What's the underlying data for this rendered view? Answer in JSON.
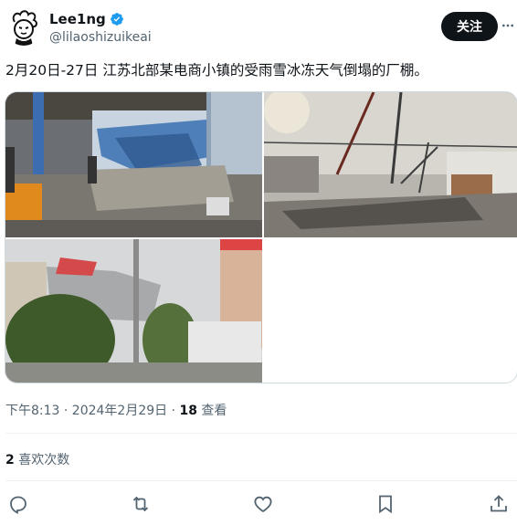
{
  "author": {
    "display_name": "Lee1ng",
    "handle": "@lilaoshizuikeai"
  },
  "header": {
    "follow_label": "关注"
  },
  "tweet": {
    "text": "2月20日-27日 江苏北部某电商小镇的受雨雪冰冻天气倒塌的厂棚。",
    "time": "下午8:13 · 2024年2月29日 · ",
    "views": "18",
    "views_label": " 查看"
  },
  "engagement": {
    "likes_count": "2",
    "likes_label": " 喜欢次数"
  },
  "icons": {
    "verified": "verified-badge-icon",
    "more": "more-options-icon",
    "reply": "reply-icon",
    "retweet": "retweet-icon",
    "like": "like-icon",
    "bookmark": "bookmark-icon",
    "share": "share-icon"
  },
  "colors": {
    "accent": "#1d9bf0",
    "text": "#0f1419",
    "secondary": "#536471",
    "border": "#cfd9de"
  }
}
